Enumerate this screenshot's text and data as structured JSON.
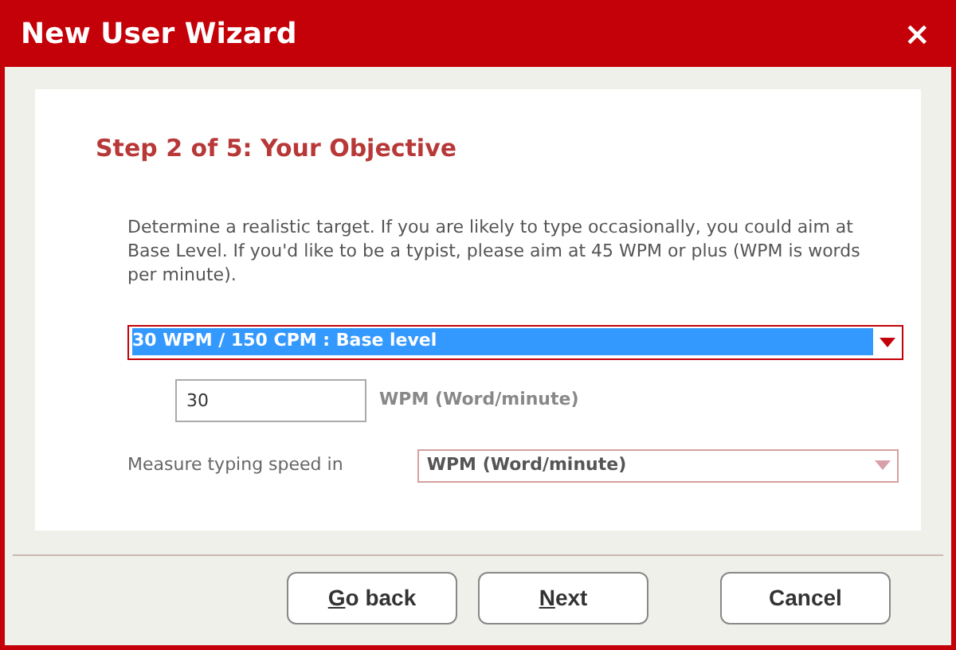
{
  "window": {
    "title": "New User Wizard",
    "close": "×"
  },
  "step_title": "Step 2 of 5: Your Objective",
  "description": "Determine a realistic target. If you are likely to type occasionally, you could aim at Base Level. If you'd like to be a typist, please aim at 45 WPM or plus (WPM is words per minute).",
  "target_select": {
    "value": "30 WPM / 150 CPM : Base level",
    "focused": true
  },
  "wpm_field": {
    "value": "30",
    "unit": "WPM (Word/minute)"
  },
  "measure": {
    "label": "Measure typing speed in",
    "value": "WPM (Word/minute)"
  },
  "buttons": [
    {
      "label": "Go back",
      "underline_first": true
    },
    {
      "label": "Next",
      "underline_first": true
    },
    {
      "label": "Cancel",
      "underline_first": false
    }
  ]
}
